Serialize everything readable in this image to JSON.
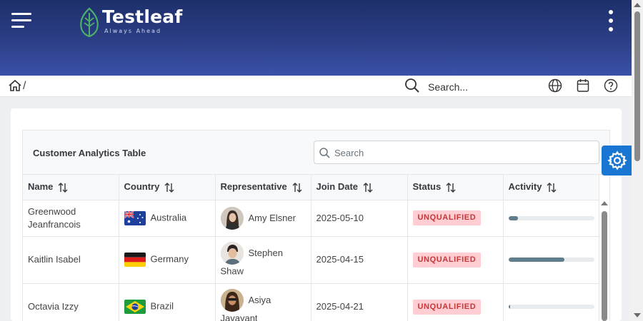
{
  "brand": {
    "name": "Testleaf",
    "tagline": "Always Ahead",
    "color": "#4caf6a"
  },
  "header": {
    "accent": "#2c3f86"
  },
  "breadcrumb": {
    "separator": "/"
  },
  "global_search": {
    "placeholder": "Search..."
  },
  "toolbar_icons": [
    "globe-icon",
    "calendar-icon",
    "help-icon"
  ],
  "table": {
    "title": "Customer Analytics Table",
    "search_placeholder": "Search",
    "columns": [
      "Name",
      "Country",
      "Representative",
      "Join Date",
      "Status",
      "Activity"
    ],
    "rows": [
      {
        "name": "Greenwood Jeanfrancois",
        "country": "Australia",
        "flag": "au",
        "representative": "Amy Elsner",
        "join_date": "2025-05-10",
        "status": "UNQUALIFIED",
        "activity": 0.11
      },
      {
        "name": "Kaitlin Isabel",
        "country": "Germany",
        "flag": "de",
        "representative": "Stephen Shaw",
        "join_date": "2025-04-15",
        "status": "UNQUALIFIED",
        "activity": 0.65
      },
      {
        "name": "Octavia Izzy",
        "country": "Brazil",
        "flag": "br",
        "representative": "Asiya Javayant",
        "join_date": "2025-04-21",
        "status": "UNQUALIFIED",
        "activity": 0.02
      }
    ]
  },
  "colors": {
    "status_unqualified_bg": "#ffcdd2",
    "status_unqualified_text": "#c63737",
    "progress_fill": "#607d8b",
    "settings_button": "#1976d2"
  }
}
